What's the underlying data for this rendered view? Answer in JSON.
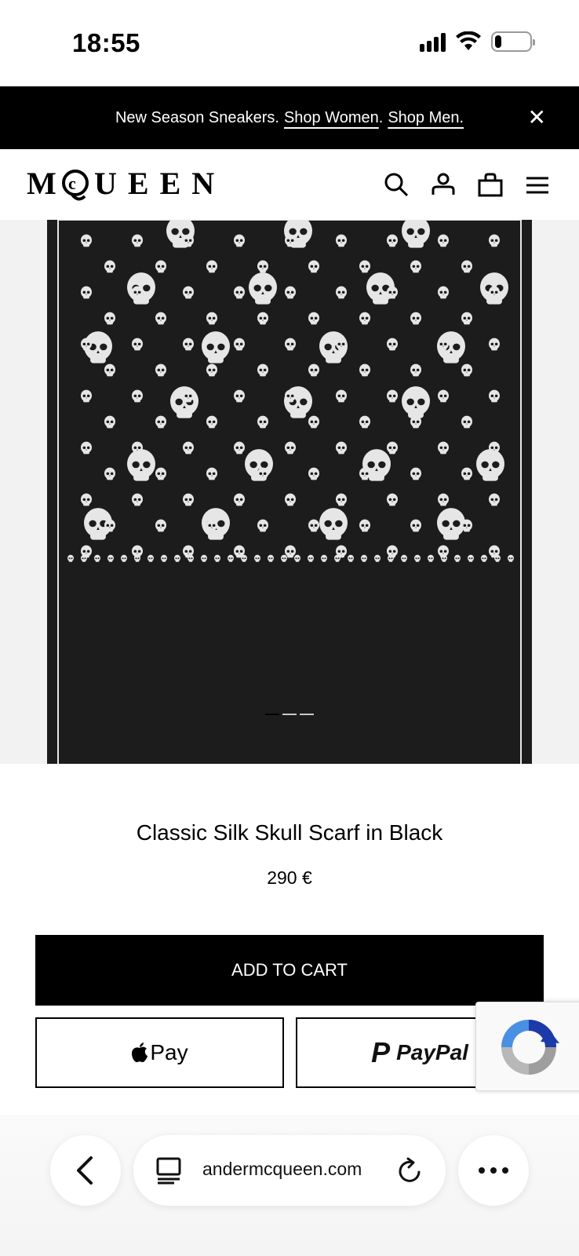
{
  "status_bar": {
    "time": "18:55",
    "icons": [
      "cellular-signal-icon",
      "wifi-icon",
      "battery-icon"
    ]
  },
  "promo_banner": {
    "text": "New Season Sneakers.",
    "link_women": "Shop Women",
    "separator": ".",
    "link_men": "Shop Men.",
    "close_icon": "close-icon"
  },
  "header": {
    "logo": "MQUEEN",
    "icons": [
      "search-icon",
      "account-icon",
      "bag-icon",
      "menu-icon"
    ]
  },
  "gallery": {
    "image_subject": "black silk scarf with white skull print",
    "slide_count": 3,
    "active_slide": 1
  },
  "product": {
    "name": "Classic Silk Skull Scarf in Black",
    "price": "290 €",
    "add_to_cart_label": "ADD TO CART",
    "apple_pay_label": "Pay",
    "paypal_label": "PayPal"
  },
  "browser": {
    "url": "andermcqueen.com",
    "icons": [
      "back-icon",
      "tabs-icon",
      "reload-icon",
      "more-icon"
    ]
  },
  "colors": {
    "primary": "#000000",
    "background": "#ffffff",
    "gallery_bg": "#f2f2f2"
  }
}
